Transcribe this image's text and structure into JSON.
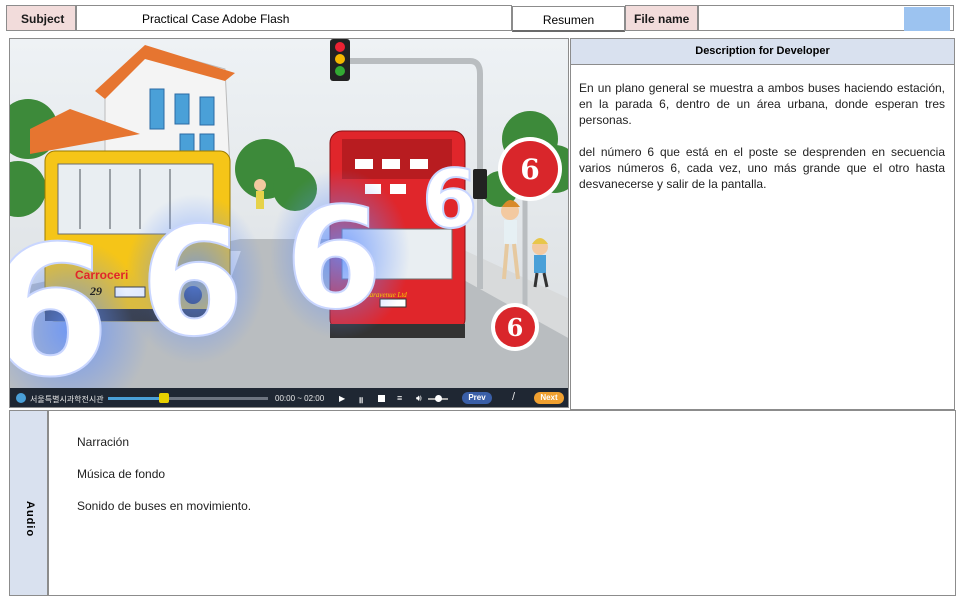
{
  "header": {
    "subject_label": "Subject",
    "subject_value": "Practical Case Adobe Flash",
    "resumen_label": "Resumen",
    "filename_label": "File name",
    "filename_value": ""
  },
  "scene": {
    "bus_yellow_brand": "Carroceri",
    "bus_yellow_number": "29",
    "bus_red_text": "Caravenue Ltd",
    "big_numbers": [
      "6",
      "6",
      "6",
      "6"
    ],
    "sign_top": "6",
    "sign_bottom": "6",
    "player": {
      "logo_text": "서울특별시과학전시관",
      "time": "00:00 ~ 02:00",
      "prev_label": "Prev",
      "separator": "/",
      "next_label": "Next",
      "progress": 0.35,
      "volume": 0.5
    }
  },
  "description": {
    "header": "Description for Developer",
    "paragraphs": [
      "En un plano general se muestra a ambos buses haciendo estación, en la parada 6, dentro de un área urbana, donde esperan tres personas.",
      "del número 6 que está en el poste se desprenden en secuencia varios números 6, cada vez, uno más grande que el otro hasta desvanecerse y salir de la pantalla."
    ]
  },
  "audio": {
    "side_label": "Audio",
    "lines": [
      "Narración",
      "Música de fondo",
      "Sonido de buses en movimiento."
    ]
  },
  "colors": {
    "label_pink": "#f2dcdb",
    "header_blue": "#d9e1ef",
    "swatch_blue": "#9cc3f0",
    "bus_yellow": "#f5c518",
    "bus_red": "#e0262b",
    "sign_red": "#d9262b",
    "next_orange": "#f0a030",
    "prev_blue": "#3a5fa8"
  }
}
